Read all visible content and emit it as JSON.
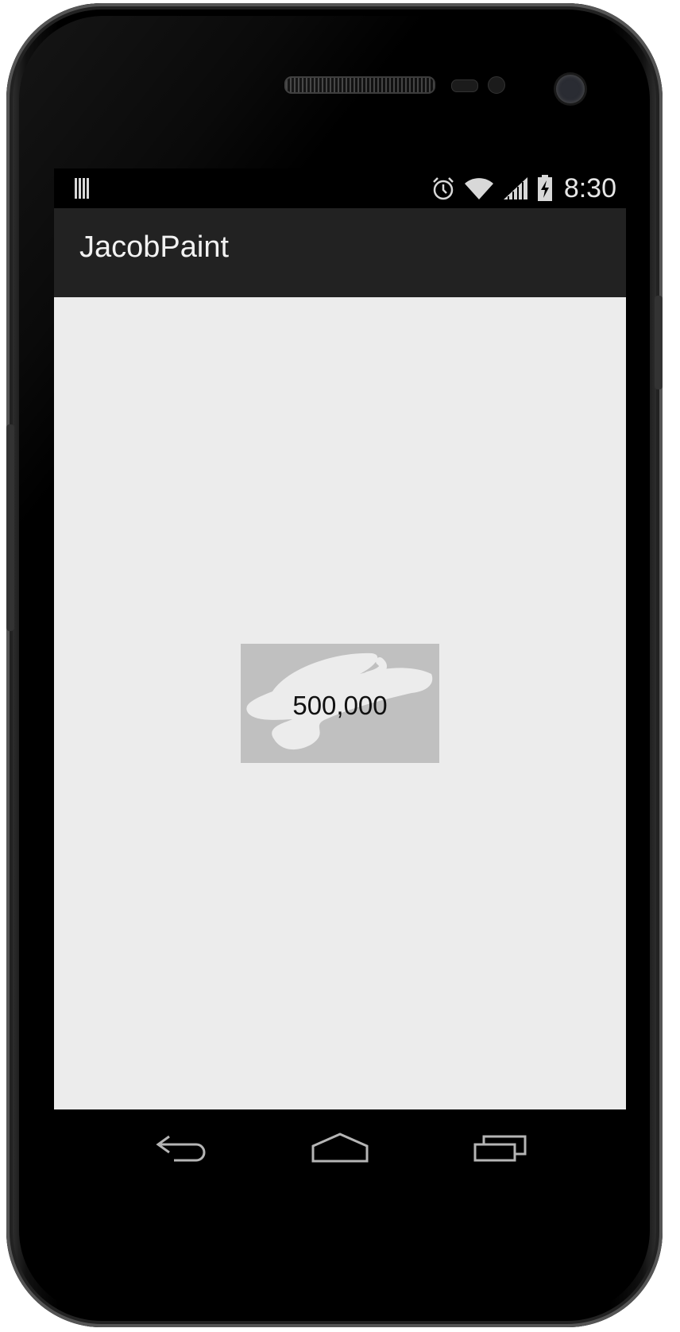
{
  "app": {
    "title": "JacobPaint"
  },
  "status_bar": {
    "time": "8:30",
    "icons": [
      "notification-icon",
      "alarm-icon",
      "wifi-icon",
      "signal-icon",
      "battery-charging-icon"
    ]
  },
  "canvas": {
    "label": "500,000"
  },
  "navigation": {
    "buttons": [
      "back-icon",
      "home-icon",
      "recent-apps-icon"
    ]
  },
  "colors": {
    "screen_background": "#ececec",
    "action_bar": "#222222",
    "status_bar": "#000000",
    "paint_view": "#c0c0c0",
    "brush_stroke": "#ececec"
  }
}
